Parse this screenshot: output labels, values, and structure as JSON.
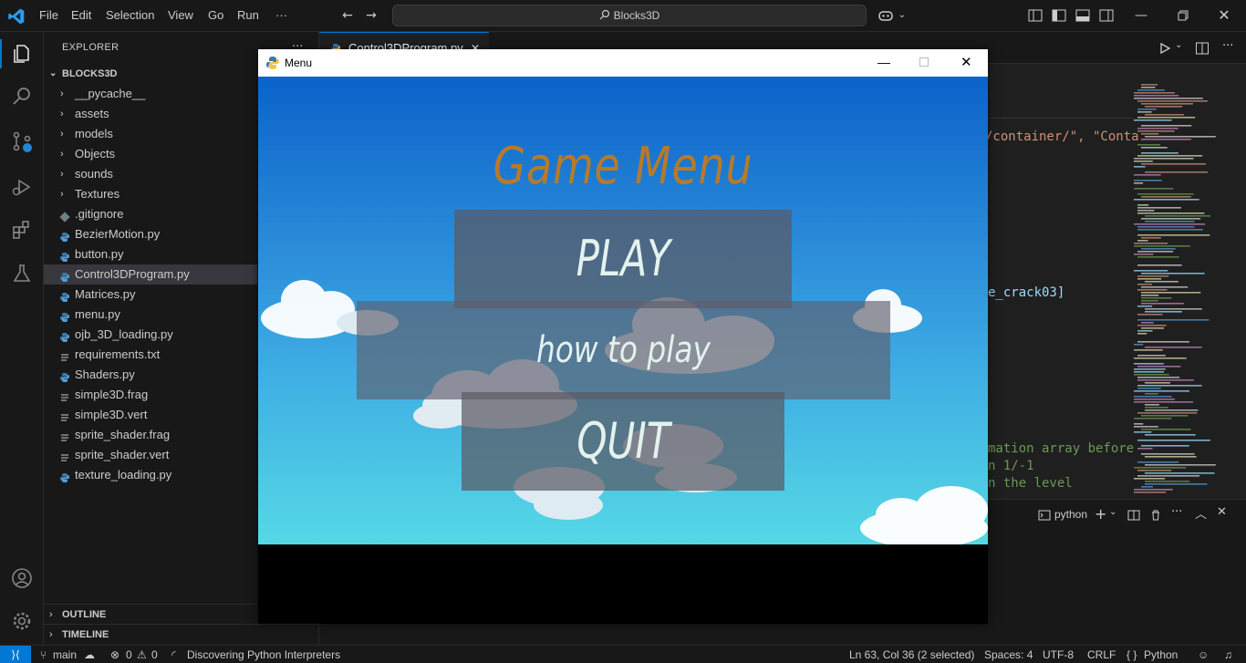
{
  "titlebar": {
    "menus": [
      "File",
      "Edit",
      "Selection",
      "View",
      "Go",
      "Run",
      "···"
    ],
    "search": "Blocks3D"
  },
  "explorer": {
    "header": "EXPLORER",
    "more": "···",
    "root": "BLOCKS3D",
    "folders": [
      "__pycache__",
      "assets",
      "models",
      "Objects",
      "sounds",
      "Textures"
    ],
    "files": [
      ".gitignore",
      "BezierMotion.py",
      "button.py",
      "Control3DProgram.py",
      "Matrices.py",
      "menu.py",
      "ojb_3D_loading.py",
      "requirements.txt",
      "Shaders.py",
      "simple3D.frag",
      "simple3D.vert",
      "sprite_shader.frag",
      "sprite_shader.vert",
      "texture_loading.py"
    ],
    "outline": "OUTLINE",
    "timeline": "TIMELINE"
  },
  "editor": {
    "tab_label": "Control3DProgram.py",
    "code_fragments": [
      "/container/\", \"Conta",
      "e_crack03]",
      "mation array before",
      "n 1/-1",
      "n the level"
    ],
    "terminal_label": "python"
  },
  "game": {
    "window_title": "Menu",
    "heading": "Game Menu",
    "buttons": [
      "PLAY",
      "how to play",
      "QUIT"
    ]
  },
  "statusbar": {
    "branch": "main",
    "errors": "0",
    "warnings": "0",
    "message": "Discovering Python Interpreters",
    "position": "Ln 63, Col 36 (2 selected)",
    "spaces": "Spaces: 4",
    "encoding": "UTF-8",
    "eol": "CRLF",
    "language": "Python",
    "language_icon": "{ }"
  },
  "colors": {
    "accent": "#0078d4",
    "title_gold": "#b87a28",
    "button_bg": "#5a5a64",
    "code_string": "#ce9178",
    "code_comment": "#6a9955"
  }
}
